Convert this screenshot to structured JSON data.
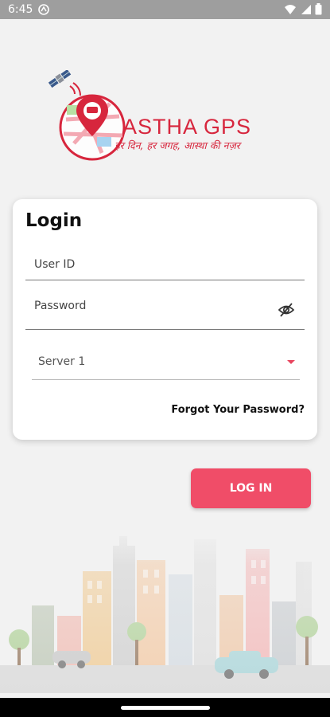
{
  "status_bar": {
    "time": "6:45"
  },
  "logo": {
    "brand_name": "ASTHA GPS",
    "tagline": "हर दिन, हर जगह, आस्था की नज़र"
  },
  "login_card": {
    "title": "Login",
    "user_id_label": "User ID",
    "password_label": "Password",
    "server_value": "Server 1",
    "forgot_password_label": "Forgot Your Password?"
  },
  "login_button_label": "LOG IN",
  "colors": {
    "accent": "#f04d68",
    "logo_red": "#d7263d",
    "background": "#f2f2f2"
  },
  "icons": [
    "satellite-icon",
    "visibility-off-icon",
    "dropdown-arrow-icon",
    "wifi-icon",
    "battery-icon"
  ]
}
